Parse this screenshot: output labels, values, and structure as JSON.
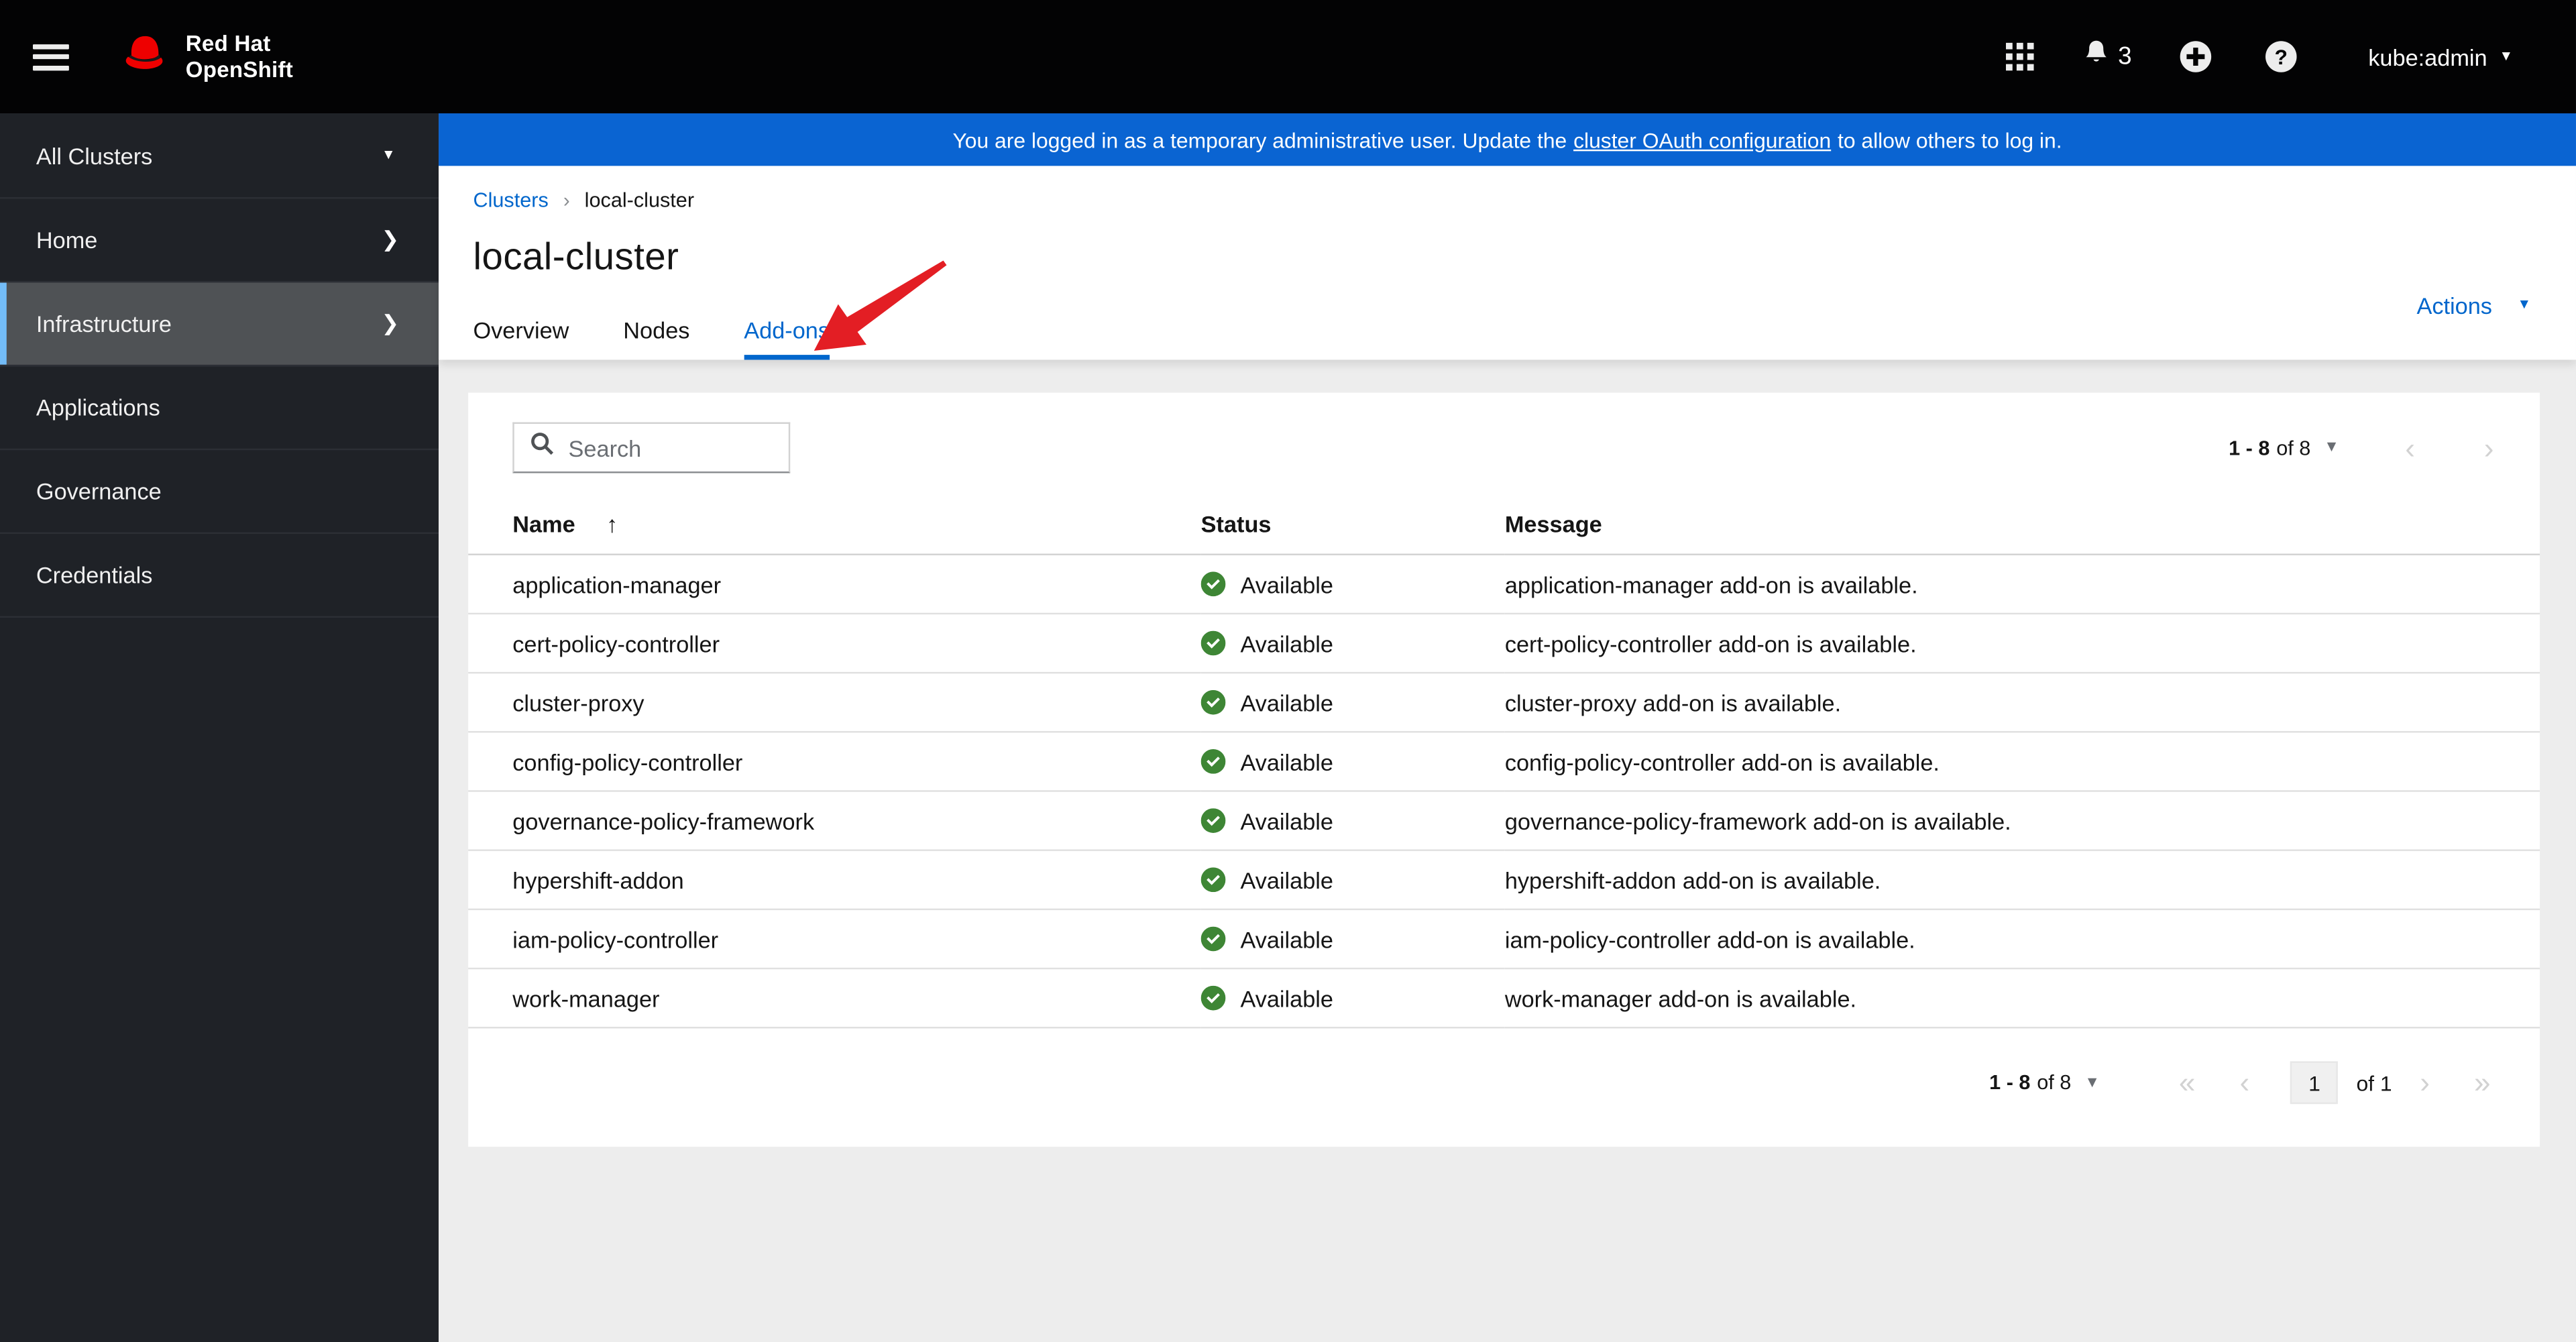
{
  "masthead": {
    "brand_line1": "Red Hat",
    "brand_line2": "OpenShift",
    "notification_count": "3",
    "username": "kube:admin"
  },
  "banner": {
    "text_before": "You are logged in as a temporary administrative user. Update the",
    "link_text": "cluster OAuth configuration",
    "text_after": "to allow others to log in."
  },
  "sidebar": {
    "cluster_selector": "All Clusters",
    "items": [
      {
        "label": "Home"
      },
      {
        "label": "Infrastructure"
      },
      {
        "label": "Applications"
      },
      {
        "label": "Governance"
      },
      {
        "label": "Credentials"
      }
    ]
  },
  "breadcrumb": {
    "parent": "Clusters",
    "current": "local-cluster"
  },
  "page": {
    "title": "local-cluster",
    "actions_label": "Actions"
  },
  "tabs": [
    {
      "label": "Overview"
    },
    {
      "label": "Nodes"
    },
    {
      "label": "Add-ons"
    }
  ],
  "toolbar": {
    "search_placeholder": "Search",
    "pagination_range": "1 - 8",
    "pagination_of": "of 8"
  },
  "table": {
    "columns": {
      "name": "Name",
      "status": "Status",
      "message": "Message"
    },
    "rows": [
      {
        "name": "application-manager",
        "status": "Available",
        "message": "application-manager add-on is available."
      },
      {
        "name": "cert-policy-controller",
        "status": "Available",
        "message": "cert-policy-controller add-on is available."
      },
      {
        "name": "cluster-proxy",
        "status": "Available",
        "message": "cluster-proxy add-on is available."
      },
      {
        "name": "config-policy-controller",
        "status": "Available",
        "message": "config-policy-controller add-on is available."
      },
      {
        "name": "governance-policy-framework",
        "status": "Available",
        "message": "governance-policy-framework add-on is available."
      },
      {
        "name": "hypershift-addon",
        "status": "Available",
        "message": "hypershift-addon add-on is available."
      },
      {
        "name": "iam-policy-controller",
        "status": "Available",
        "message": "iam-policy-controller add-on is available."
      },
      {
        "name": "work-manager",
        "status": "Available",
        "message": "work-manager add-on is available."
      }
    ]
  },
  "footer_pagination": {
    "range": "1 - 8",
    "of_total": "of 8",
    "current_page": "1",
    "of_pages": "of 1"
  },
  "icons": {
    "caret_down": "▾",
    "chevron_right_bold": "❯",
    "breadcrumb_sep": "›",
    "sort_asc_arrow": "↑",
    "nav_prev": "‹",
    "nav_next": "›",
    "nav_first": "«",
    "nav_last": "»"
  },
  "colors": {
    "accent_blue": "#0066cc",
    "banner_blue": "#0a64d2",
    "status_green": "#3e8635",
    "sidebar_selected_bg": "#4f5255",
    "sidebar_accent": "#73bcf7",
    "annotation_red": "#e31e24"
  }
}
